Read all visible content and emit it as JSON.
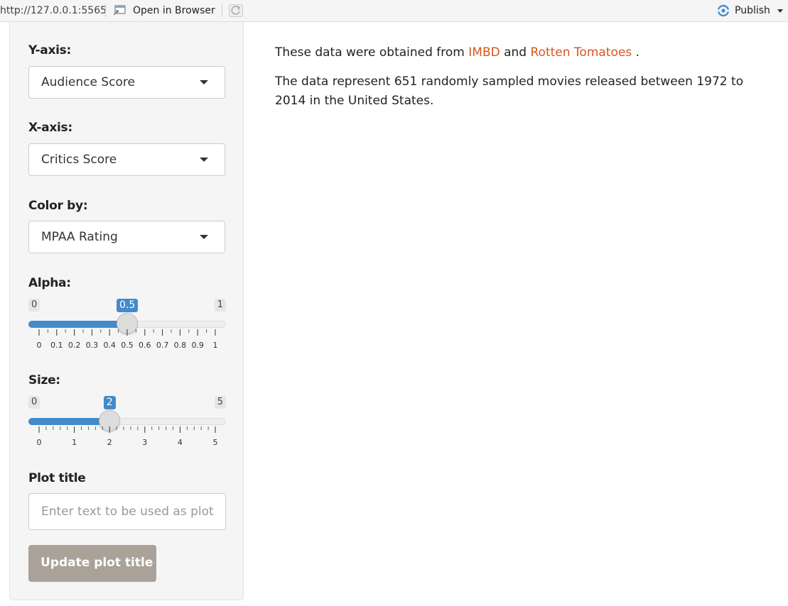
{
  "topbar": {
    "url": "http://127.0.0.1:5565",
    "open_in_browser": "Open in Browser",
    "publish": "Publish"
  },
  "sidebar": {
    "y_axis": {
      "label": "Y-axis:",
      "value": "Audience Score"
    },
    "x_axis": {
      "label": "X-axis:",
      "value": "Critics Score"
    },
    "color_by": {
      "label": "Color by:",
      "value": "MPAA Rating"
    },
    "alpha": {
      "label": "Alpha:",
      "min": "0",
      "max": "1",
      "current": "0.5",
      "fraction": 0.5,
      "ticks": [
        "0",
        "0.1",
        "0.2",
        "0.3",
        "0.4",
        "0.5",
        "0.6",
        "0.7",
        "0.8",
        "0.9",
        "1"
      ]
    },
    "size": {
      "label": "Size:",
      "min": "0",
      "max": "5",
      "current": "2",
      "fraction": 0.4,
      "ticks": [
        "0",
        "1",
        "2",
        "3",
        "4",
        "5"
      ]
    },
    "plot_title": {
      "label": "Plot title",
      "placeholder": "Enter text to be used as plot title"
    },
    "update_button": "Update plot title"
  },
  "main": {
    "intro_prefix": "These data were obtained from ",
    "link_imdb": "IMBD",
    "intro_and": " and ",
    "link_rt": "Rotten Tomatoes",
    "intro_suffix": " .",
    "description": "The data represent 651 randomly sampled movies released between 1972 to 2014 in the United States."
  },
  "colors": {
    "accent": "#428bca",
    "link": "#d9541e",
    "button": "#aaa299"
  }
}
